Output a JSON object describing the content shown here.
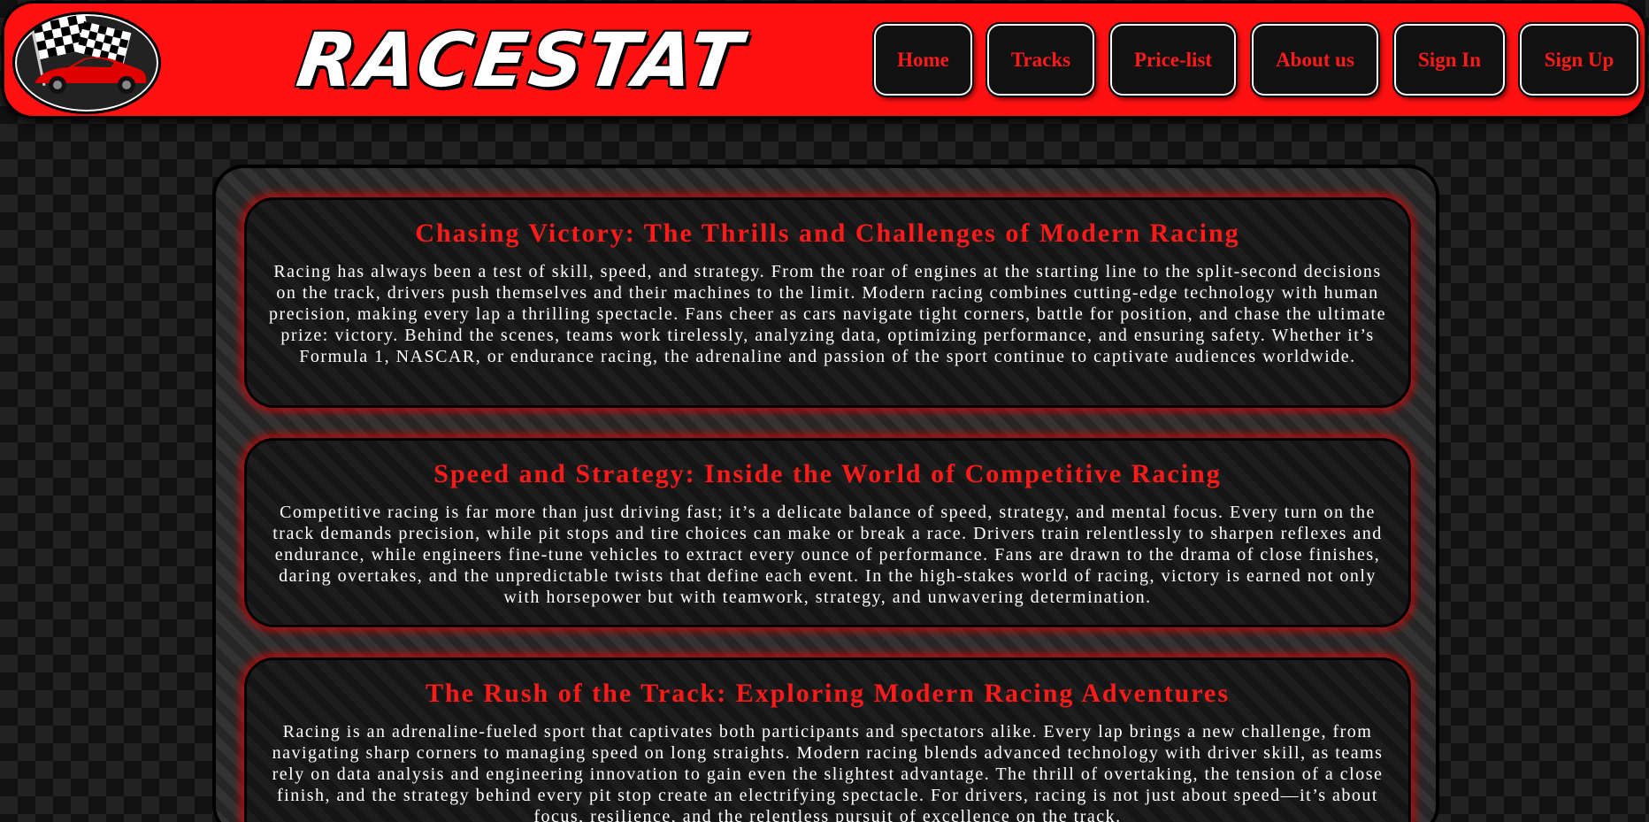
{
  "header": {
    "brand": "RACESTAT",
    "colors": {
      "accent": "#ff1111",
      "nav_text": "#ff1a1a",
      "nav_bg": "#111111"
    },
    "logo_icon": "racing-car-checkered-flag-logo"
  },
  "nav": [
    {
      "id": "home",
      "label": "Home"
    },
    {
      "id": "tracks",
      "label": "Tracks"
    },
    {
      "id": "price-list",
      "label": "Price-list"
    },
    {
      "id": "about-us",
      "label": "About us"
    },
    {
      "id": "sign-in",
      "label": "Sign In"
    },
    {
      "id": "sign-up",
      "label": "Sign Up"
    }
  ],
  "articles": [
    {
      "title": "Chasing Victory: The Thrills and Challenges of Modern Racing",
      "body": "Racing has always been a test of skill, speed, and strategy. From the roar of engines at the starting line to the split-second decisions on the track, drivers push themselves and their machines to the limit. Modern racing combines cutting-edge technology with human precision, making every lap a thrilling spectacle. Fans cheer as cars navigate tight corners, battle for position, and chase the ultimate prize: victory. Behind the scenes, teams work tirelessly, analyzing data, optimizing performance, and ensuring safety. Whether it’s Formula 1, NASCAR, or endurance racing, the adrenaline and passion of the sport continue to captivate audiences worldwide."
    },
    {
      "title": "Speed and Strategy: Inside the World of Competitive Racing",
      "body": "Competitive racing is far more than just driving fast; it’s a delicate balance of speed, strategy, and mental focus. Every turn on the track demands precision, while pit stops and tire choices can make or break a race. Drivers train relentlessly to sharpen reflexes and endurance, while engineers fine-tune vehicles to extract every ounce of performance. Fans are drawn to the drama of close finishes, daring overtakes, and the unpredictable twists that define each event. In the high-stakes world of racing, victory is earned not only with horsepower but with teamwork, strategy, and unwavering determination."
    },
    {
      "title": "The Rush of the Track: Exploring Modern Racing Adventures",
      "body": "Racing is an adrenaline-fueled sport that captivates both participants and spectators alike. Every lap brings a new challenge, from navigating sharp corners to managing speed on long straights. Modern racing blends advanced technology with driver skill, as teams rely on data analysis and engineering innovation to gain even the slightest advantage. The thrill of overtaking, the tension of a close finish, and the strategy behind every pit stop create an electrifying spectacle. For drivers, racing is not just about speed—it’s about focus, resilience, and the relentless pursuit of excellence on the track."
    }
  ]
}
